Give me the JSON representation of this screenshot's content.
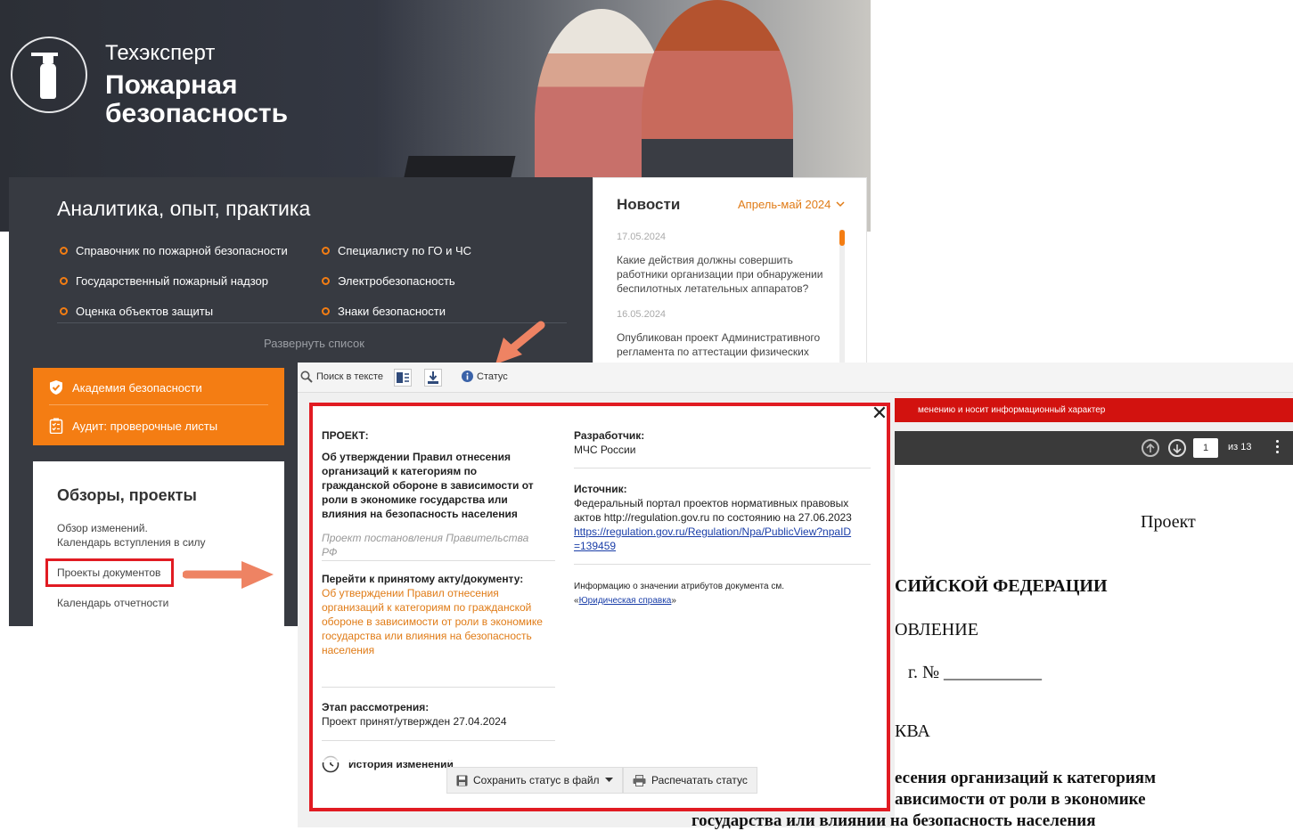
{
  "brand": {
    "product": "Техэксперт",
    "name_line1": "Пожарная",
    "name_line2": "безопасность"
  },
  "analytics": {
    "title": "Аналитика, опыт, практика",
    "items_left": [
      "Справочник по пожарной безопасности",
      "Государственный пожарный надзор",
      "Оценка объектов защиты"
    ],
    "items_right": [
      "Специалисту по ГО и ЧС",
      "Электробезопасность",
      "Знаки безопасности"
    ],
    "expand": "Развернуть список"
  },
  "news": {
    "title": "Новости",
    "period": "Апрель-май 2024",
    "items": [
      {
        "date": "17.05.2024",
        "text": "Какие действия должны совершить работники организации при обнаружении беспилотных летательных аппаратов?"
      },
      {
        "date": "16.05.2024",
        "text": "Опубликован проект Административного регламента по аттестации физических"
      }
    ]
  },
  "orange_menu": [
    "Академия безопасности",
    "Аудит: проверочные листы"
  ],
  "reviews": {
    "title": "Обзоры, проекты",
    "link1_line1": "Обзор изменений.",
    "link1_line2": "Календарь вступления в силу",
    "link2": "Проекты документов",
    "link3": "Календарь отчетности"
  },
  "toolbar": {
    "search": "Поиск в тексте",
    "status": "Статус"
  },
  "doc": {
    "notice": "менению и носит информационный характер",
    "page": "1",
    "of": "из 13",
    "lines": {
      "project": "Проект",
      "federation": "СИЙСКОЙ ФЕДЕРАЦИИ",
      "decree": "ОВЛЕНИЕ",
      "number": "г.  № ___________",
      "city": "КВА",
      "title1": "есения организаций к категориям",
      "title2": "ависимости от роли в экономике",
      "title3": "государства или влиянии на безопасность населения"
    }
  },
  "status": {
    "project_label": "ПРОЕКТ:",
    "project_title": "Об утверждении Правил отнесения организаций к категориям по гражданской обороне в зависимости от роли в экономике государства или влияния на безопасность населения",
    "project_type": "Проект постановления Правительства РФ",
    "goto_label": "Перейти к принятому акту/документу:",
    "goto_link": "Об утверждении Правил отнесения организаций к категориям по гражданской обороне в зависимости от роли в экономике государства или влияния на безопасность населения",
    "stage_label": "Этап рассмотрения:",
    "stage_value": "Проект принят/утвержден 27.04.2024",
    "history_label": "История изменений",
    "developer_label": "Разработчик:",
    "developer_value": "МЧС России",
    "source_label": "Источник:",
    "source_value": "Федеральный портал проектов нормативных правовых актов http://regulation.gov.ru по состоянию на 27.06.2023",
    "source_link_line1": "https://regulation.gov.ru/Regulation/Npa/PublicView?npaID",
    "source_link_line2": "=139459",
    "info_prefix": "Информацию о значении атрибутов документа см.",
    "info_open": "«",
    "info_link": "Юридическая справка",
    "info_close": "»",
    "save_btn": "Сохранить статус в файл",
    "print_btn": "Распечатать статус"
  }
}
